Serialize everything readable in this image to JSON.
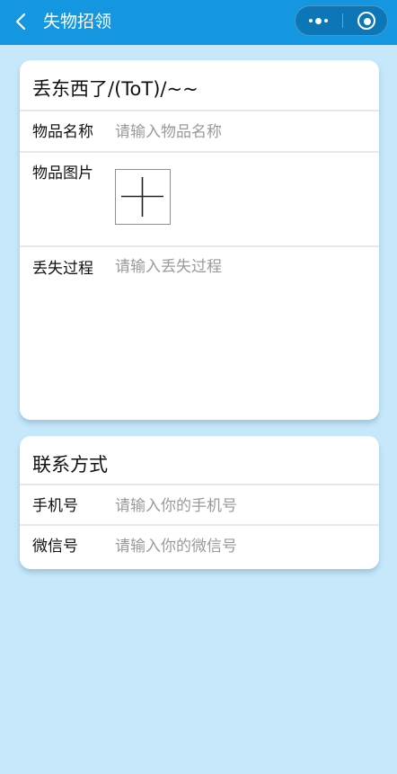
{
  "navbar": {
    "title": "失物招领",
    "back_icon": "chevron-left-icon",
    "more_icon": "more-dots-icon",
    "close_icon": "target-circle-icon"
  },
  "lost_card": {
    "title": "丢东西了/(ToT)/~~",
    "name_label": "物品名称",
    "name_placeholder": "请输入物品名称",
    "name_value": "",
    "image_label": "物品图片",
    "upload_icon": "plus-icon",
    "process_label": "丢失过程",
    "process_placeholder": "请输入丢失过程",
    "process_value": ""
  },
  "contact_card": {
    "title": "联系方式",
    "phone_label": "手机号",
    "phone_placeholder": "请输入你的手机号",
    "phone_value": "",
    "wechat_label": "微信号",
    "wechat_placeholder": "请输入你的微信号",
    "wechat_value": ""
  },
  "colors": {
    "navbar_bg": "#1596e1",
    "page_bg": "#c6e8fa",
    "card_bg": "#ffffff",
    "placeholder": "#9a9a9a"
  }
}
